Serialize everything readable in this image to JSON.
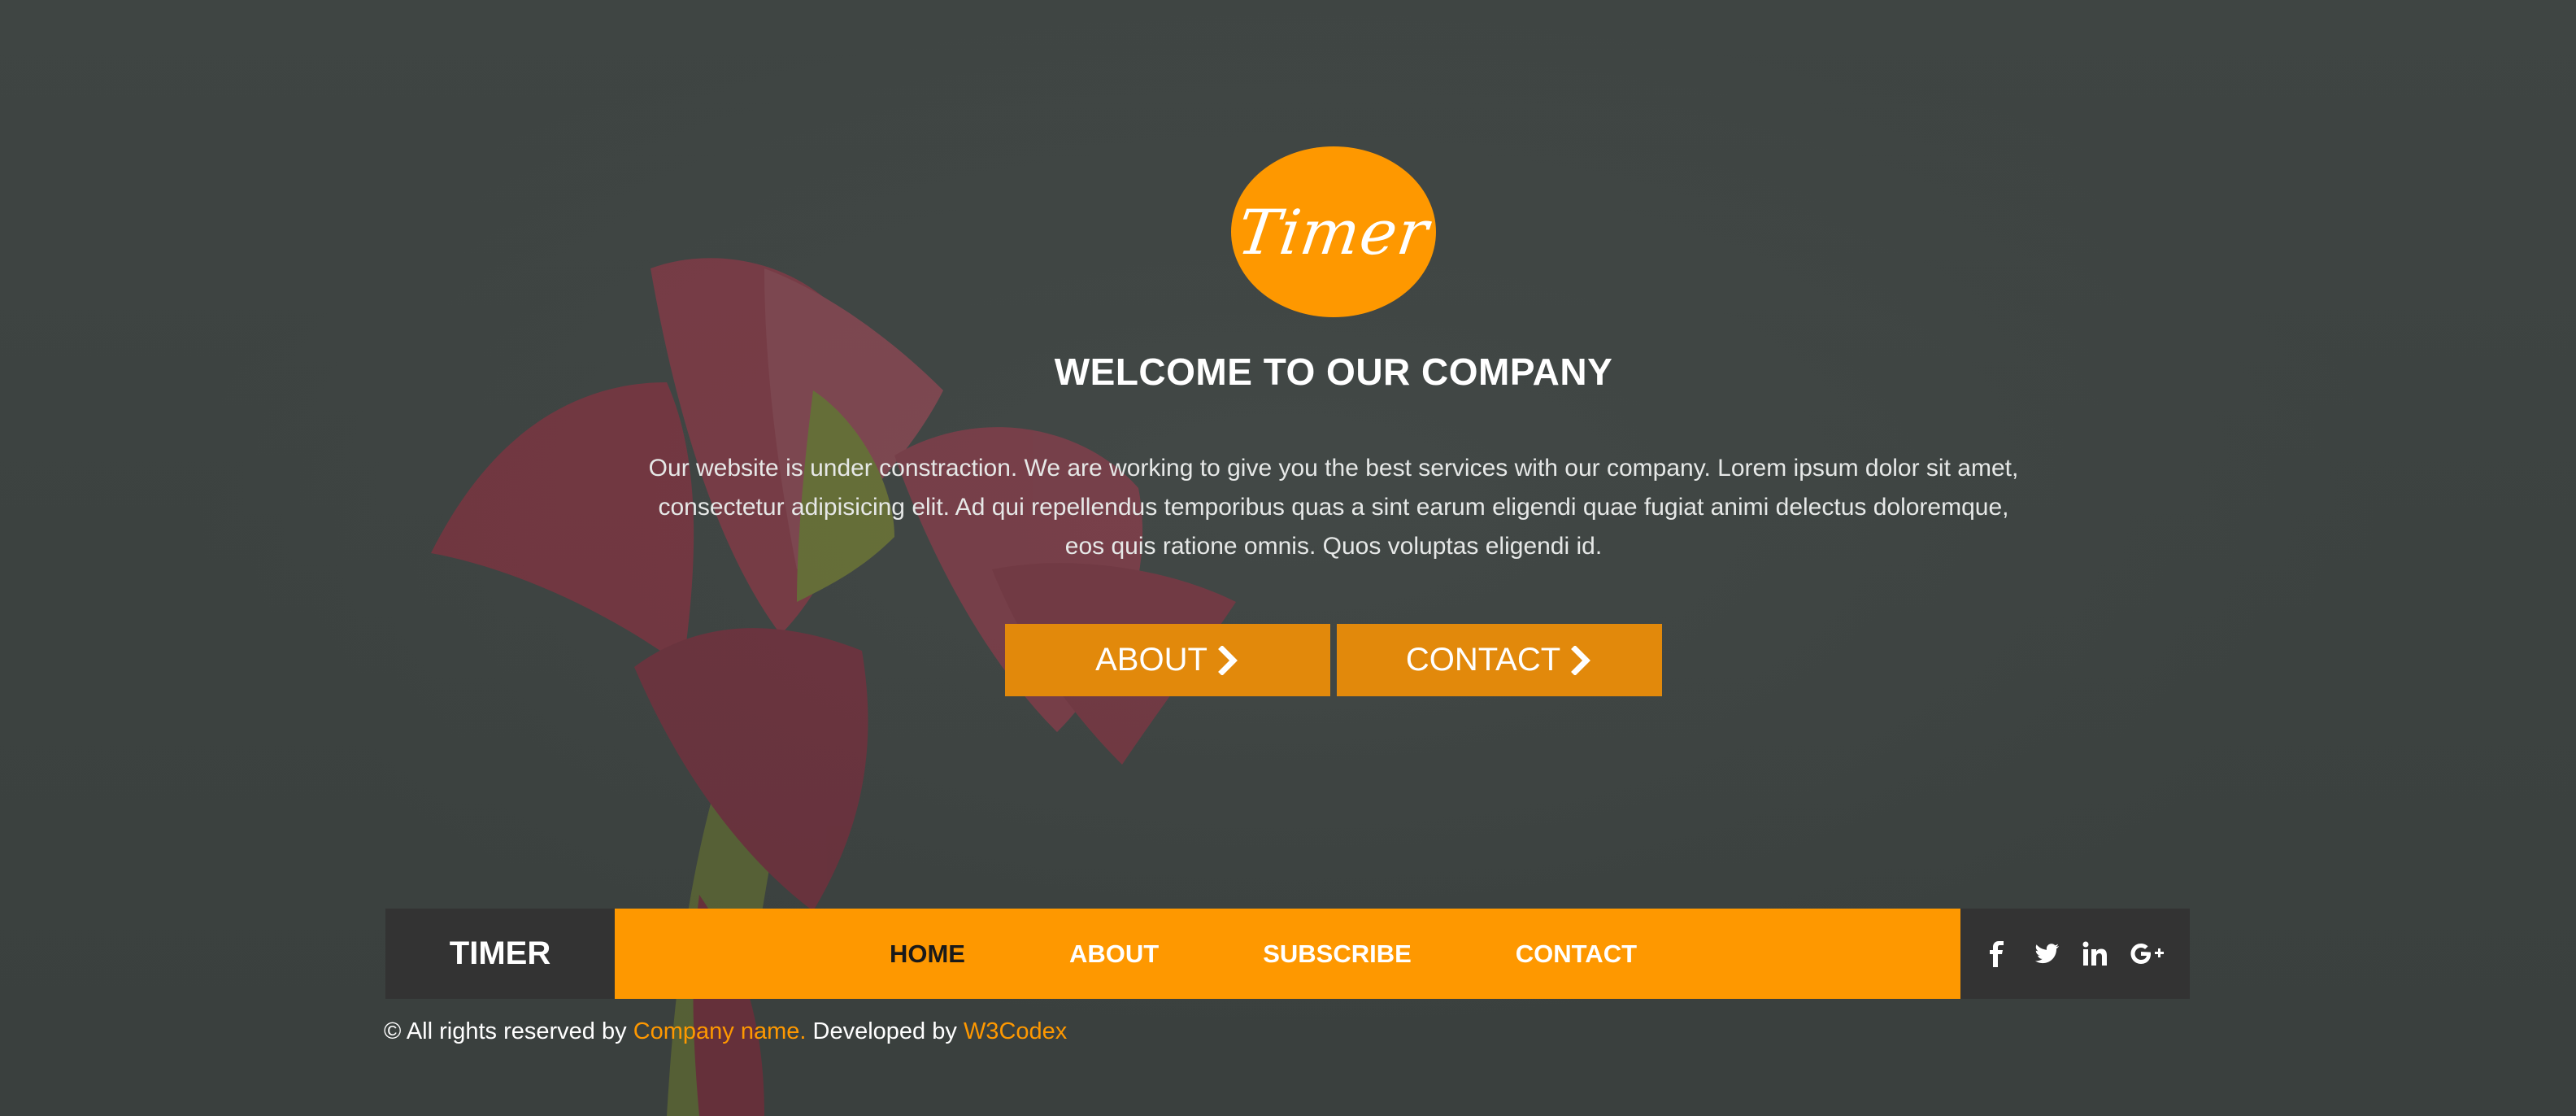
{
  "colors": {
    "accent": "#fe9800",
    "button": "#e2890b",
    "dark": "#333333",
    "background": "#3d4341"
  },
  "hero": {
    "logo_text": "Timer",
    "title": "WELCOME TO OUR COMPANY",
    "description": "Our website is under constraction. We are working to give you the best services with our company. Lorem ipsum dolor sit amet, consectetur adipisicing elit. Ad qui repellendus temporibus quas a sint earum eligendi quae fugiat animi delectus doloremque, eos quis ratione omnis. Quos voluptas eligendi id.",
    "buttons": {
      "about_label": "ABOUT",
      "contact_label": "CONTACT",
      "icon": "chevron-right-icon"
    }
  },
  "navbar": {
    "brand": "TIMER",
    "items": [
      {
        "label": "HOME",
        "active": true
      },
      {
        "label": "ABOUT",
        "active": false
      },
      {
        "label": "SUBSCRIBE",
        "active": false
      },
      {
        "label": "CONTACT",
        "active": false
      }
    ],
    "social_icons": [
      "facebook-icon",
      "twitter-icon",
      "linkedin-icon",
      "google-plus-icon"
    ]
  },
  "footer": {
    "copyright_symbol": "©",
    "prefix": "All rights reserved by",
    "company_link": "Company name.",
    "developed_by": "Developed by",
    "developer_link": "W3Codex"
  }
}
